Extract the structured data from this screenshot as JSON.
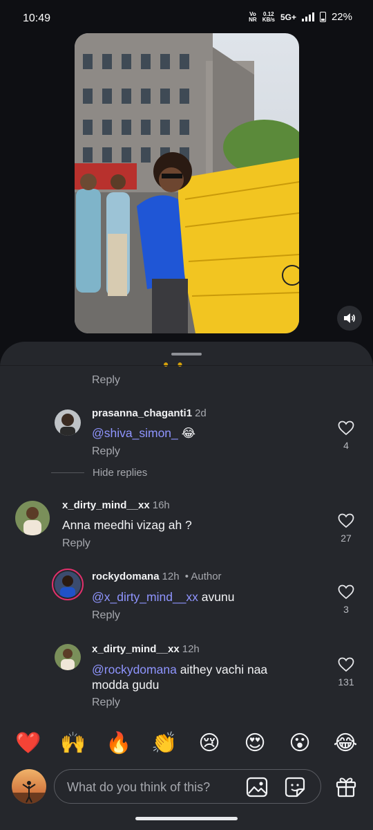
{
  "status_bar": {
    "time": "10:49",
    "volte_top": "Vo",
    "volte_bottom": "NR",
    "speed_top": "0.12",
    "speed_bottom": "KB/s",
    "network": "5G+",
    "battery": "22%"
  },
  "video": {
    "mute_icon": "speaker-icon"
  },
  "comments": {
    "reply_label": "Reply",
    "hide_replies_label": "Hide replies",
    "items": [
      {
        "username": "prasanna_chaganti1",
        "time": "2d",
        "mention": "@shiva_simon_",
        "text": " 😂",
        "likes": "4"
      },
      {
        "username": "x_dirty_mind__xx",
        "time": "16h",
        "text": "Anna meedhi vizag ah ?",
        "likes": "27"
      },
      {
        "username": "rockydomana",
        "time": "12h",
        "badge": "• Author",
        "mention": "@x_dirty_mind__xx",
        "text": " avunu",
        "likes": "3"
      },
      {
        "username": "x_dirty_mind__xx",
        "time": "12h",
        "mention": "@rockydomana",
        "text": " aithey vachi naa modda gudu",
        "likes": "131"
      }
    ]
  },
  "quick_reactions": [
    "❤️",
    "🙌",
    "🔥",
    "👏",
    "😢",
    "😍",
    "😮",
    "😂"
  ],
  "composer": {
    "placeholder": "What do you think of this?",
    "image_icon": "image-icon",
    "sticker_icon": "sticker-icon",
    "gift_icon": "gift-icon"
  },
  "colors": {
    "sheet_bg": "#25272c",
    "mention": "#8f95ff",
    "secondary_text": "#a6a8ae"
  }
}
